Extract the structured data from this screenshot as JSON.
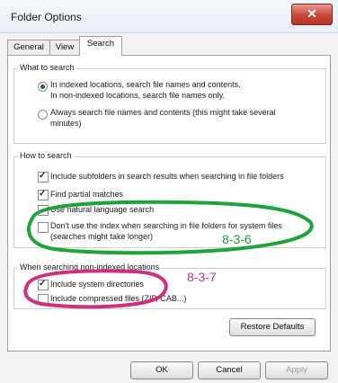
{
  "window": {
    "title": "Folder Options",
    "close_glyph": "✕"
  },
  "tabs": [
    {
      "label": "General",
      "active": false
    },
    {
      "label": "View",
      "active": false
    },
    {
      "label": "Search",
      "active": true
    }
  ],
  "what_to_search": {
    "legend": "What to search",
    "option1_line1": "In indexed locations, search file names and contents.",
    "option1_line2": "In non-indexed locations, search file names only.",
    "option2_line1": "Always search file names and contents (this might take several",
    "option2_line2": "minutes)",
    "selected": "option1"
  },
  "how_to_search": {
    "legend": "How to search",
    "items": [
      {
        "label": "Include subfolders in search results when searching in file folders",
        "checked": true
      },
      {
        "label": "Find partial matches",
        "checked": true
      },
      {
        "label": "Use natural language search",
        "checked": false
      },
      {
        "label_line1": "Don't use the index when searching in file folders for system files",
        "label_line2": "(searches might take longer)",
        "checked": false
      }
    ]
  },
  "non_indexed": {
    "legend": "When searching non-indexed locations",
    "items": [
      {
        "label": "Include system directories",
        "checked": true
      },
      {
        "label": "Include compressed files (ZIP, CAB...)",
        "checked": false
      }
    ]
  },
  "buttons": {
    "restore_defaults": "Restore Defaults",
    "ok": "OK",
    "cancel": "Cancel",
    "apply": "Apply"
  },
  "annotations": [
    {
      "text": "8-3-6",
      "color": "#1fa33a"
    },
    {
      "text": "8-3-7",
      "color": "#cf2f7c"
    }
  ]
}
